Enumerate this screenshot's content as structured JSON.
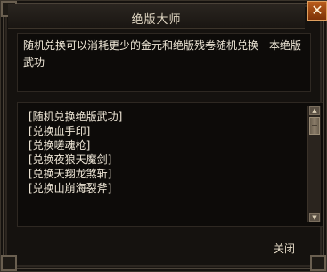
{
  "window": {
    "title": "绝版大师",
    "close_glyph": "✕"
  },
  "description": {
    "text": "随机兑换可以消耗更少的金元和绝版残卷随机兑换一本绝版武功"
  },
  "exchange_list": {
    "items": [
      "[随机兑换绝版武功]",
      "[兑换血手印]",
      "[兑换嗟魂枪]",
      "[兑换夜狼天魔剑]",
      "[兑换天翔龙煞斩]",
      "[兑换山崩海裂斧]"
    ]
  },
  "footer": {
    "close_label": "关闭"
  }
}
